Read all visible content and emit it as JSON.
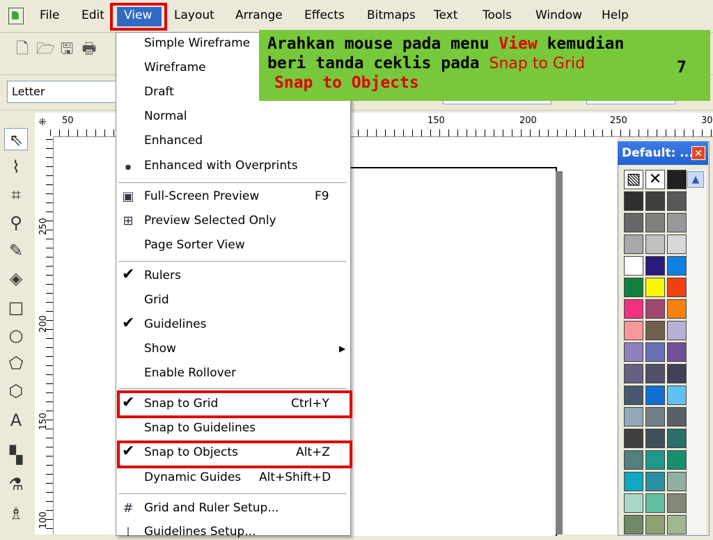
{
  "menubar": {
    "items": [
      "File",
      "Edit",
      "View",
      "Layout",
      "Arrange",
      "Effects",
      "Bitmaps",
      "Text",
      "Tools",
      "Window",
      "Help"
    ]
  },
  "propbar": {
    "paper_size": "Letter"
  },
  "rulers": {
    "h_labels": [
      "50",
      "150",
      "200",
      "250",
      "30"
    ],
    "v_labels": [
      "250",
      "200",
      "150",
      "100"
    ]
  },
  "view_menu": {
    "items": [
      {
        "label": "Simple Wireframe",
        "shortcut": "",
        "checked": false
      },
      {
        "label": "Wireframe",
        "shortcut": "",
        "checked": false
      },
      {
        "label": "Draft",
        "shortcut": "",
        "checked": false
      },
      {
        "label": "Normal",
        "shortcut": "",
        "checked": false
      },
      {
        "label": "Enhanced",
        "shortcut": "",
        "checked": false
      },
      {
        "label": "Enhanced with Overprints",
        "shortcut": "",
        "checked": false
      },
      {
        "label": "Full-Screen Preview",
        "shortcut": "F9",
        "checked": false
      },
      {
        "label": "Preview Selected Only",
        "shortcut": "",
        "checked": false
      },
      {
        "label": "Page Sorter View",
        "shortcut": "",
        "checked": false
      },
      {
        "label": "Rulers",
        "shortcut": "",
        "checked": true
      },
      {
        "label": "Grid",
        "shortcut": "",
        "checked": false
      },
      {
        "label": "Guidelines",
        "shortcut": "",
        "checked": true
      },
      {
        "label": "Show",
        "shortcut": "",
        "checked": false
      },
      {
        "label": "Enable Rollover",
        "shortcut": "",
        "checked": false
      },
      {
        "label": "Snap to Grid",
        "shortcut": "Ctrl+Y",
        "checked": true
      },
      {
        "label": "Snap to Guidelines",
        "shortcut": "",
        "checked": false
      },
      {
        "label": "Snap to Objects",
        "shortcut": "Alt+Z",
        "checked": true
      },
      {
        "label": "Dynamic Guides",
        "shortcut": "Alt+Shift+D",
        "checked": false
      },
      {
        "label": "Grid and Ruler Setup...",
        "shortcut": "",
        "checked": false
      },
      {
        "label": "Guidelines Setup...",
        "shortcut": "",
        "checked": false
      }
    ]
  },
  "palette": {
    "title": "Default: ...",
    "colors": [
      "#303030",
      "#404040",
      "#585858",
      "#686868",
      "#808080",
      "#989898",
      "#a8a8a8",
      "#c0c0c0",
      "#d8d8d8",
      "#ffffff",
      "#2a1a7a",
      "#1080e0",
      "#108040",
      "#f8f800",
      "#f04010",
      "#f03080",
      "#a04870",
      "#f88010",
      "#f89898",
      "#706050",
      "#b8b0d8",
      "#9080c0",
      "#6870b8",
      "#705098",
      "#686080",
      "#505068",
      "#404058",
      "#485870",
      "#1070d0",
      "#60c0f0",
      "#90a8b8",
      "#708088",
      "#586068",
      "#404040",
      "#405058",
      "#287068",
      "#508080",
      "#209888",
      "#189070",
      "#10a8c0",
      "#2890a0",
      "#90b0a0",
      "#a8d8c8",
      "#60c0a0",
      "#808878",
      "#708868",
      "#90a070",
      "#a0b890"
    ]
  },
  "callout": {
    "line1_a": "Arahkan mouse pada menu ",
    "line1_b": "View",
    "line1_c": " kemudian",
    "line2_a": "beri tanda ceklis pada ",
    "line2_b": "Snap to Grid",
    "line2_num": "7",
    "line3": "Snap to Objects",
    "colors": {
      "bg": "#77c83a",
      "text": "#000000",
      "highlight": "#e10000"
    }
  }
}
